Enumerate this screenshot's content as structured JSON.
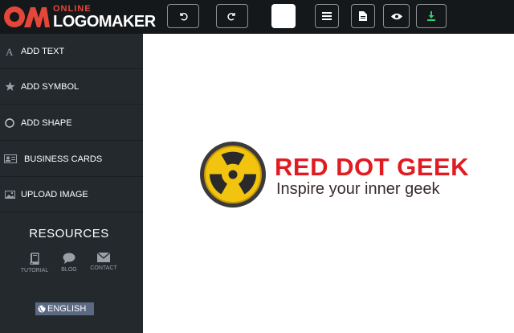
{
  "app": {
    "logo_online": "ONLINE",
    "logo_brand": "LOGOMAKER"
  },
  "toolbar": {
    "buttons": [
      {
        "name": "undo",
        "icon": "undo-icon"
      },
      {
        "name": "redo",
        "icon": "redo-icon"
      },
      {
        "name": "color-swatch",
        "icon": "color-swatch"
      },
      {
        "name": "layers",
        "icon": "list-icon"
      },
      {
        "name": "file",
        "icon": "file-icon"
      },
      {
        "name": "preview",
        "icon": "eye-icon"
      },
      {
        "name": "download",
        "icon": "download-icon"
      }
    ]
  },
  "sidebar": {
    "items": [
      {
        "label": "ADD TEXT",
        "icon": "text-icon"
      },
      {
        "label": "ADD SYMBOL",
        "icon": "star-icon"
      },
      {
        "label": "ADD SHAPE",
        "icon": "circle-icon"
      },
      {
        "label": "BUSINESS CARDS",
        "icon": "id-card-icon"
      },
      {
        "label": "UPLOAD IMAGE",
        "icon": "image-icon"
      }
    ],
    "resources_title": "RESOURCES",
    "resources": [
      {
        "label": "TUTORIAL",
        "icon": "book-icon"
      },
      {
        "label": "BLOG",
        "icon": "comment-icon"
      },
      {
        "label": "CONTACT",
        "icon": "envelope-icon"
      }
    ],
    "language": "ENGLISH"
  },
  "canvas": {
    "brand_name": "RED DOT GEEK",
    "tagline": "Inspire your inner geek"
  },
  "colors": {
    "brand_red": "#e11b22",
    "accent_green": "#2ecc71",
    "topbar_bg": "#15181b",
    "sidebar_bg": "#24292e",
    "radiation_yellow": "#f2c40f"
  }
}
